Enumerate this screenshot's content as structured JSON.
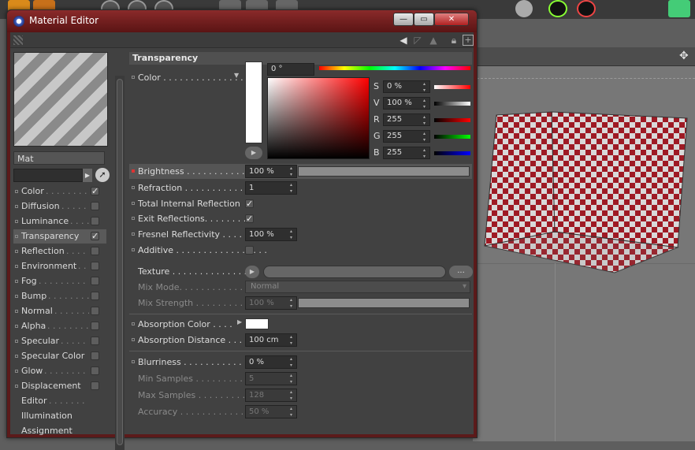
{
  "window": {
    "title": "Material Editor",
    "close_label": "✕",
    "min_label": "—",
    "max_label": "▭"
  },
  "material": {
    "name": "Mat"
  },
  "channels": [
    {
      "label": "Color",
      "dots": ". . . . . . . . . .",
      "checked": true,
      "selected": false
    },
    {
      "label": "Diffusion",
      "dots": ". . . . . . . . .",
      "checked": false,
      "selected": false
    },
    {
      "label": "Luminance",
      "dots": ". . . . . . .",
      "checked": false,
      "selected": false
    },
    {
      "label": "Transparency",
      "dots": "",
      "checked": true,
      "selected": true
    },
    {
      "label": "Reflection",
      "dots": ". . . . . . .",
      "checked": false,
      "selected": false
    },
    {
      "label": "Environment",
      "dots": ". . . .",
      "checked": false,
      "selected": false
    },
    {
      "label": "Fog",
      "dots": ". . . . . . . . . . . .",
      "checked": false,
      "selected": false
    },
    {
      "label": "Bump",
      "dots": ". . . . . . . . . . .",
      "checked": false,
      "selected": false
    },
    {
      "label": "Normal",
      "dots": ". . . . . . . . .",
      "checked": false,
      "selected": false
    },
    {
      "label": "Alpha",
      "dots": ". . . . . . . . . .",
      "checked": false,
      "selected": false
    },
    {
      "label": "Specular",
      "dots": ". . . . . . .",
      "checked": false,
      "selected": false
    },
    {
      "label": "Specular Color",
      "dots": "",
      "checked": false,
      "selected": false
    },
    {
      "label": "Glow",
      "dots": ". . . . . . . . . . .",
      "checked": false,
      "selected": false
    },
    {
      "label": "Displacement",
      "dots": "",
      "checked": false,
      "selected": false
    },
    {
      "label": "Editor",
      "dots": ". . . . . . .",
      "checked": null,
      "selected": false
    },
    {
      "label": "Illumination",
      "dots": "",
      "checked": null,
      "selected": false
    },
    {
      "label": "Assignment",
      "dots": "",
      "checked": null,
      "selected": false
    }
  ],
  "section": {
    "title": "Transparency"
  },
  "color": {
    "label": "Color . . . . . . . . . . . . . . . .",
    "hue": "0 °",
    "rows": [
      {
        "key": "S",
        "value": "0 %",
        "bar_from": "#ffffff",
        "bar_to": "#ff0000"
      },
      {
        "key": "V",
        "value": "100 %",
        "bar_from": "#000000",
        "bar_to": "#ffffff"
      },
      {
        "key": "R",
        "value": "255",
        "bar_from": "#000000",
        "bar_to": "#ff0000"
      },
      {
        "key": "G",
        "value": "255",
        "bar_from": "#000000",
        "bar_to": "#00ff00"
      },
      {
        "key": "B",
        "value": "255",
        "bar_from": "#000000",
        "bar_to": "#0000ff"
      }
    ]
  },
  "params": {
    "brightness": {
      "label": "Brightness . . . . . . . . . . . . . . .",
      "value": "100 %",
      "level": 1.0
    },
    "refraction": {
      "label": "Refraction . . . . . . . . . . . . . .",
      "value": "1"
    },
    "total_internal": {
      "label": "Total Internal Reflection",
      "checked": "✓"
    },
    "exit_reflections": {
      "label": "Exit Reflections. . . . . . . .",
      "checked": "✓"
    },
    "fresnel": {
      "label": "Fresnel Reflectivity . . . .",
      "value": "100 %"
    },
    "additive": {
      "label": "Additive . . . . . . . . . . . . . . . . .",
      "checked": ""
    },
    "texture": {
      "label": "Texture . . . . . . . . . . . . . . . .",
      "more": "..."
    },
    "mix_mode": {
      "label": "Mix Mode. . . . . . . . . . . . . . .",
      "value": "Normal"
    },
    "mix_strength": {
      "label": "Mix Strength . . . . . . . . . . .",
      "value": "100 %",
      "level": 1.0
    },
    "absorption_color": {
      "label": "Absorption Color . . . ."
    },
    "absorption_distance": {
      "label": "Absorption Distance . . .",
      "value": "100 cm"
    },
    "blurriness": {
      "label": "Blurriness . . . . . . . . . . . . . .",
      "value": "0 %"
    },
    "min_samples": {
      "label": "Min Samples . . . . . . . . . . .",
      "value": "5"
    },
    "max_samples": {
      "label": "Max Samples . . . . . . . . . . .",
      "value": "128"
    },
    "accuracy": {
      "label": "Accuracy . . . . . . . . . . . . . . .",
      "value": "50 %"
    }
  }
}
